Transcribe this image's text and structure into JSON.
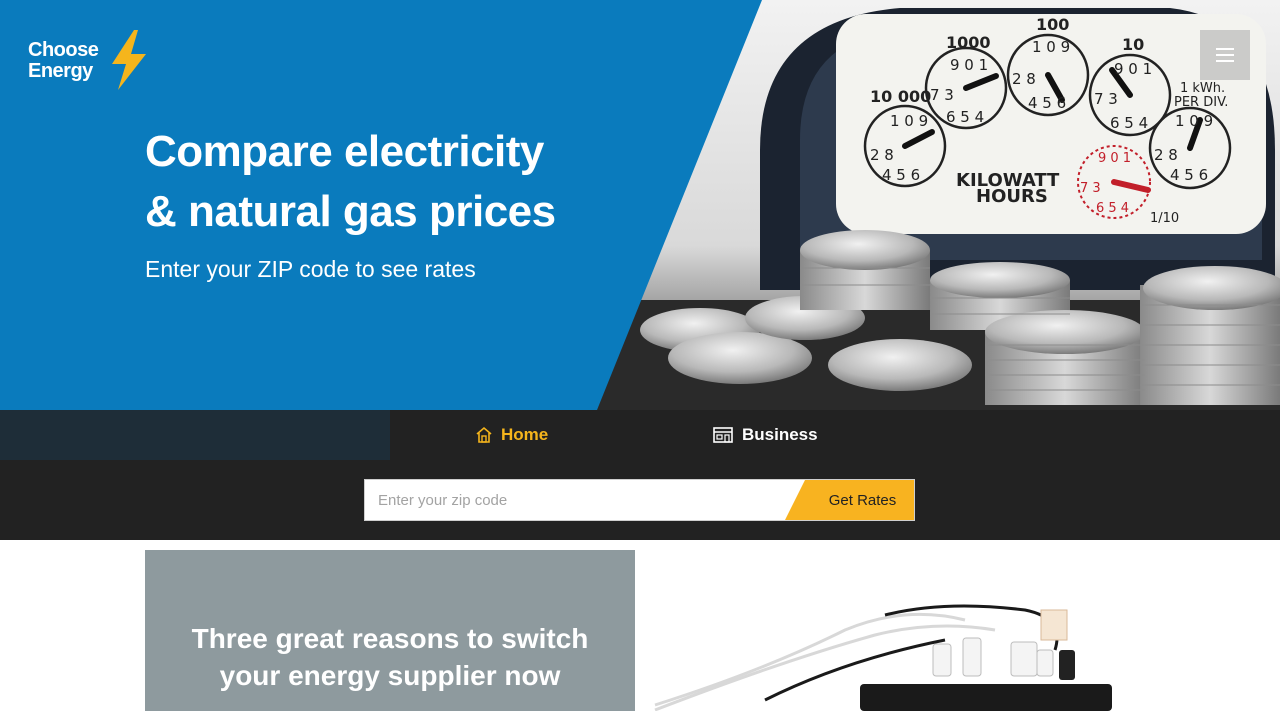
{
  "brand": {
    "name_line1": "Choose",
    "name_line2": "Energy",
    "accent": "#f5b51c",
    "blue": "#0a7bbd"
  },
  "hero": {
    "headline_line1": "Compare electricity",
    "headline_line2": "& natural gas prices",
    "subhead": "Enter your ZIP code to see rates",
    "meter": {
      "label_line1": "KILOWATT",
      "label_line2": "HOURS",
      "kwh_line1": "1 kWh.",
      "kwh_line2": "PER DIV.",
      "dials": [
        "10 000",
        "1000",
        "100",
        "10"
      ],
      "fraction": "1/10"
    }
  },
  "menu": {
    "icon": "hamburger-icon"
  },
  "tabs": [
    {
      "label": "Home",
      "icon": "house-icon",
      "active": true
    },
    {
      "label": "Business",
      "icon": "storefront-icon",
      "active": false
    }
  ],
  "zip": {
    "placeholder": "Enter your zip code",
    "value": "",
    "button_label": "Get Rates"
  },
  "promo": {
    "title_line1": "Three great reasons to switch",
    "title_line2": "your energy supplier now"
  }
}
